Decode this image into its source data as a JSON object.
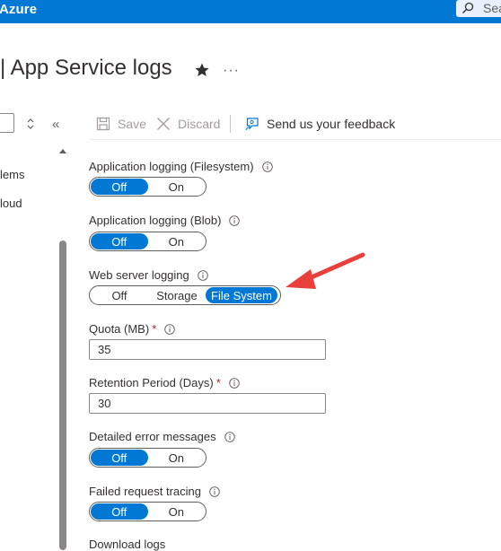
{
  "header": {
    "brand": "Azure",
    "search_placeholder": "Sea"
  },
  "page": {
    "title": "| App Service logs",
    "more": "···"
  },
  "left_nav": {
    "collapse": "«",
    "items": [
      {
        "label": "lems"
      },
      {
        "label": "loud"
      }
    ]
  },
  "toolbar": {
    "save_label": "Save",
    "discard_label": "Discard",
    "feedback_label": "Send us your feedback"
  },
  "settings": {
    "app_logging_fs": {
      "label": "Application logging (Filesystem)",
      "options": [
        "Off",
        "On"
      ],
      "selected": "Off"
    },
    "app_logging_blob": {
      "label": "Application logging (Blob)",
      "options": [
        "Off",
        "On"
      ],
      "selected": "Off"
    },
    "web_server_logging": {
      "label": "Web server logging",
      "options": [
        "Off",
        "Storage",
        "File System"
      ],
      "selected": "File System"
    },
    "quota": {
      "label": "Quota (MB)",
      "required": "*",
      "value": "35"
    },
    "retention": {
      "label": "Retention Period (Days)",
      "required": "*",
      "value": "30"
    },
    "detailed_errors": {
      "label": "Detailed error messages",
      "options": [
        "Off",
        "On"
      ],
      "selected": "Off"
    },
    "failed_request": {
      "label": "Failed request tracing",
      "options": [
        "Off",
        "On"
      ],
      "selected": "Off"
    },
    "download_logs": {
      "label": "Download logs"
    }
  },
  "colors": {
    "accent": "#0078d4",
    "annotation_arrow": "#e8413c",
    "required": "#a4262c"
  },
  "icons": {
    "search": "search-icon",
    "star": "star-icon",
    "save": "save-icon",
    "discard": "discard-icon",
    "feedback": "feedback-icon",
    "info": "info-icon"
  }
}
